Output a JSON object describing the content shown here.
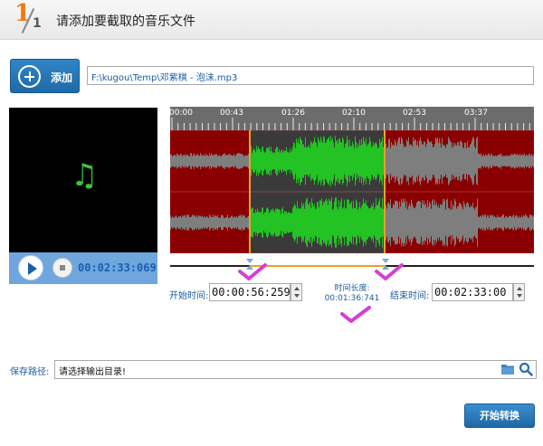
{
  "header": {
    "step_main": "1",
    "step_sub": "1",
    "title": "请添加要截取的音乐文件"
  },
  "add_button": {
    "label": "添加"
  },
  "file": {
    "path": "F:\\kugou\\Temp\\邓紫棋 - 泡沫.mp3"
  },
  "player": {
    "time": "00:02:33:069",
    "icon": "music-note-icon"
  },
  "ruler": {
    "labels": [
      "00:00",
      "00:43",
      "01:26",
      "02:10",
      "02:53",
      "03:37"
    ]
  },
  "selection": {
    "start_label": "开始时间:",
    "start_value": "00:00:56:259",
    "duration_label": "时间长度:",
    "duration_value": "00:01:36:741",
    "end_label": "结束时间:",
    "end_value": "00:02:33:00"
  },
  "save": {
    "label": "保存路径:",
    "value": "请选择输出目录!"
  },
  "start_button": {
    "label": "开始转换"
  },
  "colors": {
    "accent": "#1f6aa8",
    "wave_bg": "#8a0000",
    "wave_gray": "#7e7e7e",
    "wave_green": "#22c322",
    "selection_line": "#e7a227",
    "check": "#d43fd6"
  }
}
